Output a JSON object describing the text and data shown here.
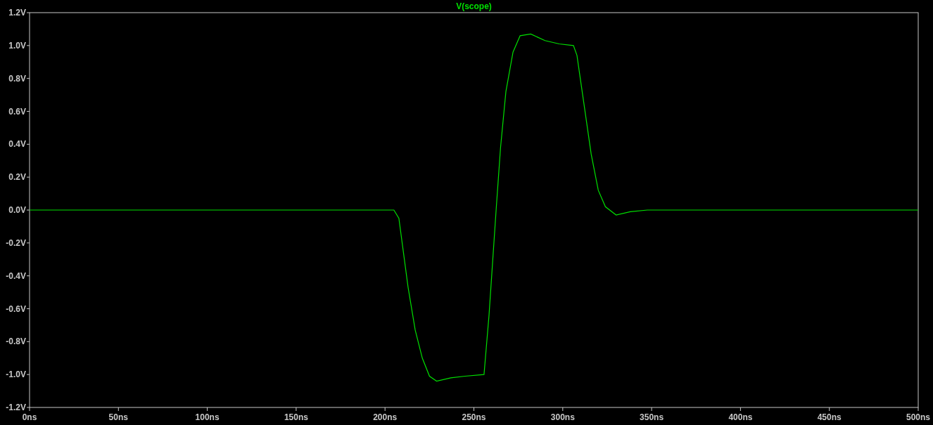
{
  "plot": {
    "chart_data": {
      "type": "line",
      "x": [
        0,
        100,
        200,
        205,
        207.8,
        213,
        217,
        221,
        225,
        229,
        237,
        245,
        255.7,
        258.5,
        262.5,
        265,
        268,
        272,
        276,
        282,
        290,
        298,
        306,
        308,
        312,
        316,
        320,
        324,
        330,
        338,
        347.6,
        400,
        500
      ],
      "series": [
        {
          "name": "V(scope)",
          "color": "#00e000",
          "values": [
            0,
            0,
            0,
            0,
            -0.05,
            -0.47,
            -0.73,
            -0.9,
            -1.01,
            -1.04,
            -1.02,
            -1.01,
            -1.0,
            -0.64,
            0,
            0.38,
            0.72,
            0.96,
            1.06,
            1.07,
            1.03,
            1.01,
            1.0,
            0.94,
            0.64,
            0.34,
            0.12,
            0.02,
            -0.03,
            -0.01,
            0,
            0,
            0
          ]
        }
      ],
      "xlim": [
        0,
        500
      ],
      "ylim": [
        -1.2,
        1.2
      ],
      "xticks": [
        {
          "value": 0,
          "label": "0ns"
        },
        {
          "value": 50,
          "label": "50ns"
        },
        {
          "value": 100,
          "label": "100ns"
        },
        {
          "value": 150,
          "label": "150ns"
        },
        {
          "value": 200,
          "label": "200ns"
        },
        {
          "value": 250,
          "label": "250ns"
        },
        {
          "value": 300,
          "label": "300ns"
        },
        {
          "value": 350,
          "label": "350ns"
        },
        {
          "value": 400,
          "label": "400ns"
        },
        {
          "value": 450,
          "label": "450ns"
        },
        {
          "value": 500,
          "label": "500ns"
        }
      ],
      "yticks": [
        {
          "value": 1.2,
          "label": "1.2V"
        },
        {
          "value": 1.0,
          "label": "1.0V"
        },
        {
          "value": 0.8,
          "label": "0.8V"
        },
        {
          "value": 0.6,
          "label": "0.6V"
        },
        {
          "value": 0.4,
          "label": "0.4V"
        },
        {
          "value": 0.2,
          "label": "0.2V"
        },
        {
          "value": 0,
          "label": "0.0V"
        },
        {
          "value": -0.2,
          "label": "-0.2V"
        },
        {
          "value": -0.4,
          "label": "-0.4V"
        },
        {
          "value": -0.6,
          "label": "-0.6V"
        },
        {
          "value": -0.8,
          "label": "-0.8V"
        },
        {
          "value": -1.0,
          "label": "-1.0V"
        },
        {
          "value": -1.2,
          "label": "-1.2V"
        }
      ]
    }
  }
}
